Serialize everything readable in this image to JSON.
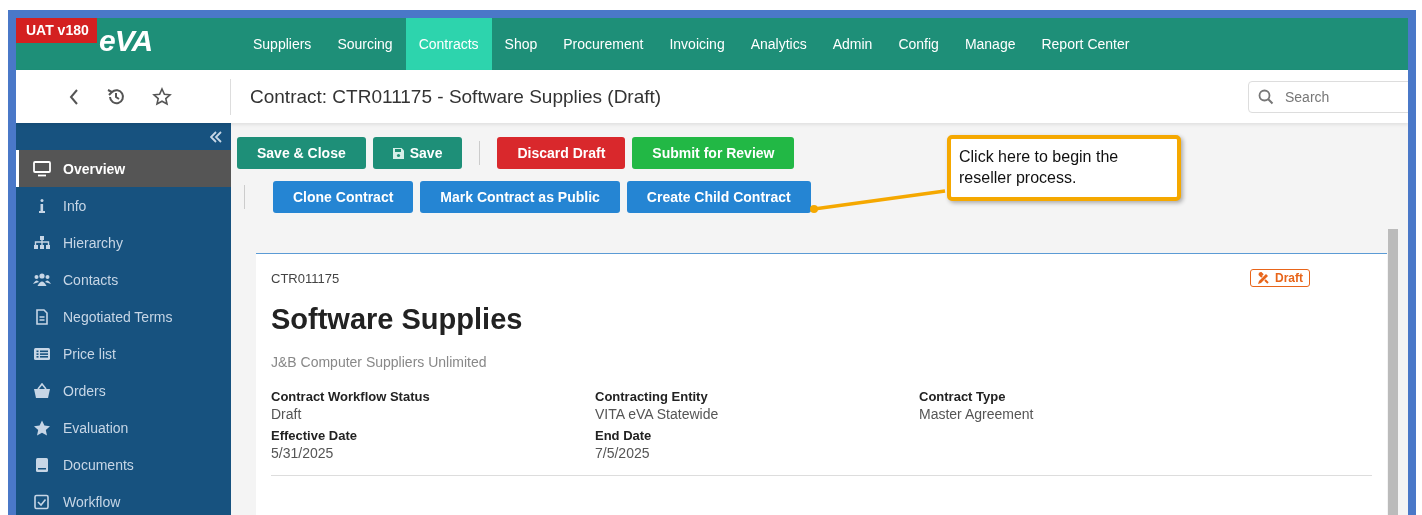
{
  "env_badge": "UAT v180",
  "logo": "eVA",
  "nav": [
    {
      "label": "Suppliers",
      "selected": false
    },
    {
      "label": "Sourcing",
      "selected": false
    },
    {
      "label": "Contracts",
      "selected": true
    },
    {
      "label": "Shop",
      "selected": false
    },
    {
      "label": "Procurement",
      "selected": false
    },
    {
      "label": "Invoicing",
      "selected": false
    },
    {
      "label": "Analytics",
      "selected": false
    },
    {
      "label": "Admin",
      "selected": false
    },
    {
      "label": "Config",
      "selected": false
    },
    {
      "label": "Manage",
      "selected": false
    },
    {
      "label": "Report Center",
      "selected": false
    }
  ],
  "page_title": "Contract: CTR011175 - Software Supplies (Draft)",
  "search": {
    "placeholder": "Search"
  },
  "sidebar": {
    "items": [
      {
        "label": "Overview",
        "selected": true
      },
      {
        "label": "Info",
        "selected": false
      },
      {
        "label": "Hierarchy",
        "selected": false
      },
      {
        "label": "Contacts",
        "selected": false
      },
      {
        "label": "Negotiated Terms",
        "selected": false
      },
      {
        "label": "Price list",
        "selected": false
      },
      {
        "label": "Orders",
        "selected": false
      },
      {
        "label": "Evaluation",
        "selected": false
      },
      {
        "label": "Documents",
        "selected": false
      },
      {
        "label": "Workflow",
        "selected": false
      }
    ]
  },
  "toolbar": [
    [
      {
        "label": "Save & Close",
        "kind": "primary"
      },
      {
        "label": "Save",
        "kind": "primary"
      },
      {
        "label": "Discard Draft",
        "kind": "danger"
      },
      {
        "label": "Submit for Review",
        "kind": "success"
      }
    ],
    [
      {
        "label": "Clone Contract",
        "kind": "info"
      },
      {
        "label": "Mark Contract as Public",
        "kind": "info"
      },
      {
        "label": "Create Child Contract",
        "kind": "info"
      }
    ]
  ],
  "callout": "Click here to begin the reseller process.",
  "card": {
    "id": "CTR011175",
    "status_badge": "Draft",
    "title": "Software Supplies",
    "supplier": "J&B Computer Suppliers Unlimited",
    "fields": [
      {
        "label": "Contract Workflow Status",
        "value": "Draft"
      },
      {
        "label": "Contracting Entity",
        "value": "VITA eVA Statewide"
      },
      {
        "label": "Contract Type",
        "value": "Master Agreement"
      },
      {
        "label": "Effective Date",
        "value": "5/31/2025"
      },
      {
        "label": "End Date",
        "value": "7/5/2025"
      }
    ]
  }
}
